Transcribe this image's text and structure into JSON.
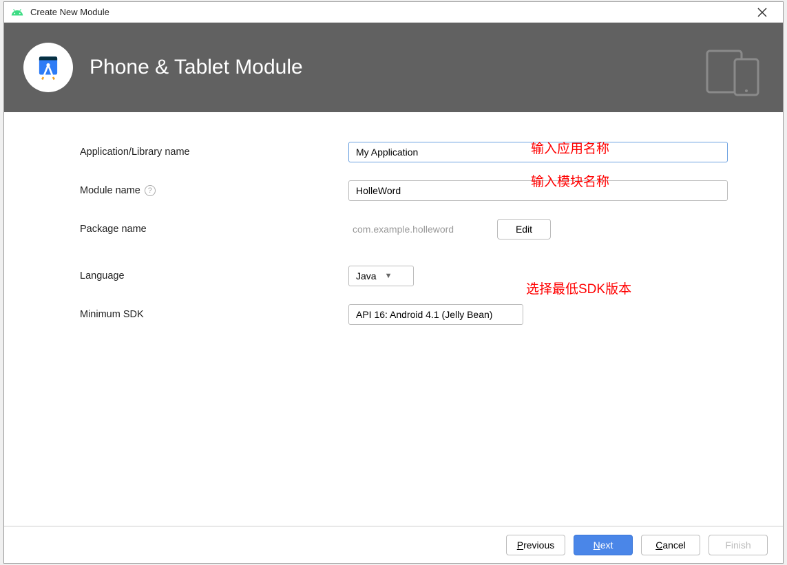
{
  "titlebar": {
    "title": "Create New Module"
  },
  "header": {
    "title": "Phone & Tablet Module"
  },
  "form": {
    "app_name_label": "Application/Library name",
    "app_name_value": "My Application",
    "module_name_label": "Module name",
    "module_name_value": "HolleWord",
    "package_label": "Package name",
    "package_value": "com.example.holleword",
    "edit_label": "Edit",
    "language_label": "Language",
    "language_value": "Java",
    "min_sdk_label": "Minimum SDK",
    "min_sdk_value": "API 16: Android 4.1 (Jelly Bean)"
  },
  "annotations": {
    "app_name": "输入应用名称",
    "module_name": "输入模块名称",
    "min_sdk": "选择最低SDK版本"
  },
  "footer": {
    "previous": "revious",
    "next": "ext",
    "cancel": "ancel",
    "finish": "Finish"
  },
  "colors": {
    "header_bg": "#616161",
    "primary": "#4a86e8",
    "annotation": "#ff0000"
  }
}
